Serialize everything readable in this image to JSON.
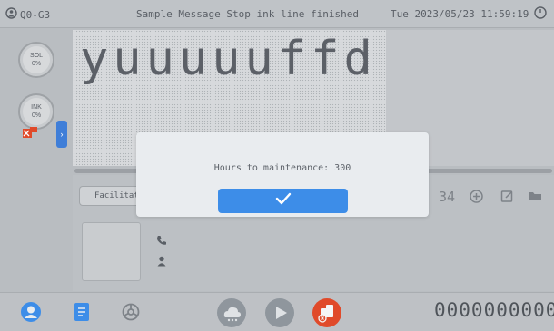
{
  "topbar": {
    "device": "Q0-G3",
    "title": "Sample Message Stop ink line finished",
    "datetime": "Tue 2023/05/23 11:59:19",
    "power_icon": "power-icon"
  },
  "gauges": {
    "sol": {
      "label": "SOL",
      "value": "0%"
    },
    "ink": {
      "label": "INK",
      "value": "0%"
    }
  },
  "preview": {
    "message": "yuuuuuffd"
  },
  "lower": {
    "facilitator": "Facilitat",
    "count": "34"
  },
  "modal": {
    "text": "Hours to maintenance: 300",
    "ok_icon": "checkmark-icon"
  },
  "bottombar": {
    "counter": "0000000000"
  },
  "colors": {
    "accent": "#3d8de8",
    "stop": "#e04a2a",
    "dim_accent": "#7f8a9a"
  }
}
